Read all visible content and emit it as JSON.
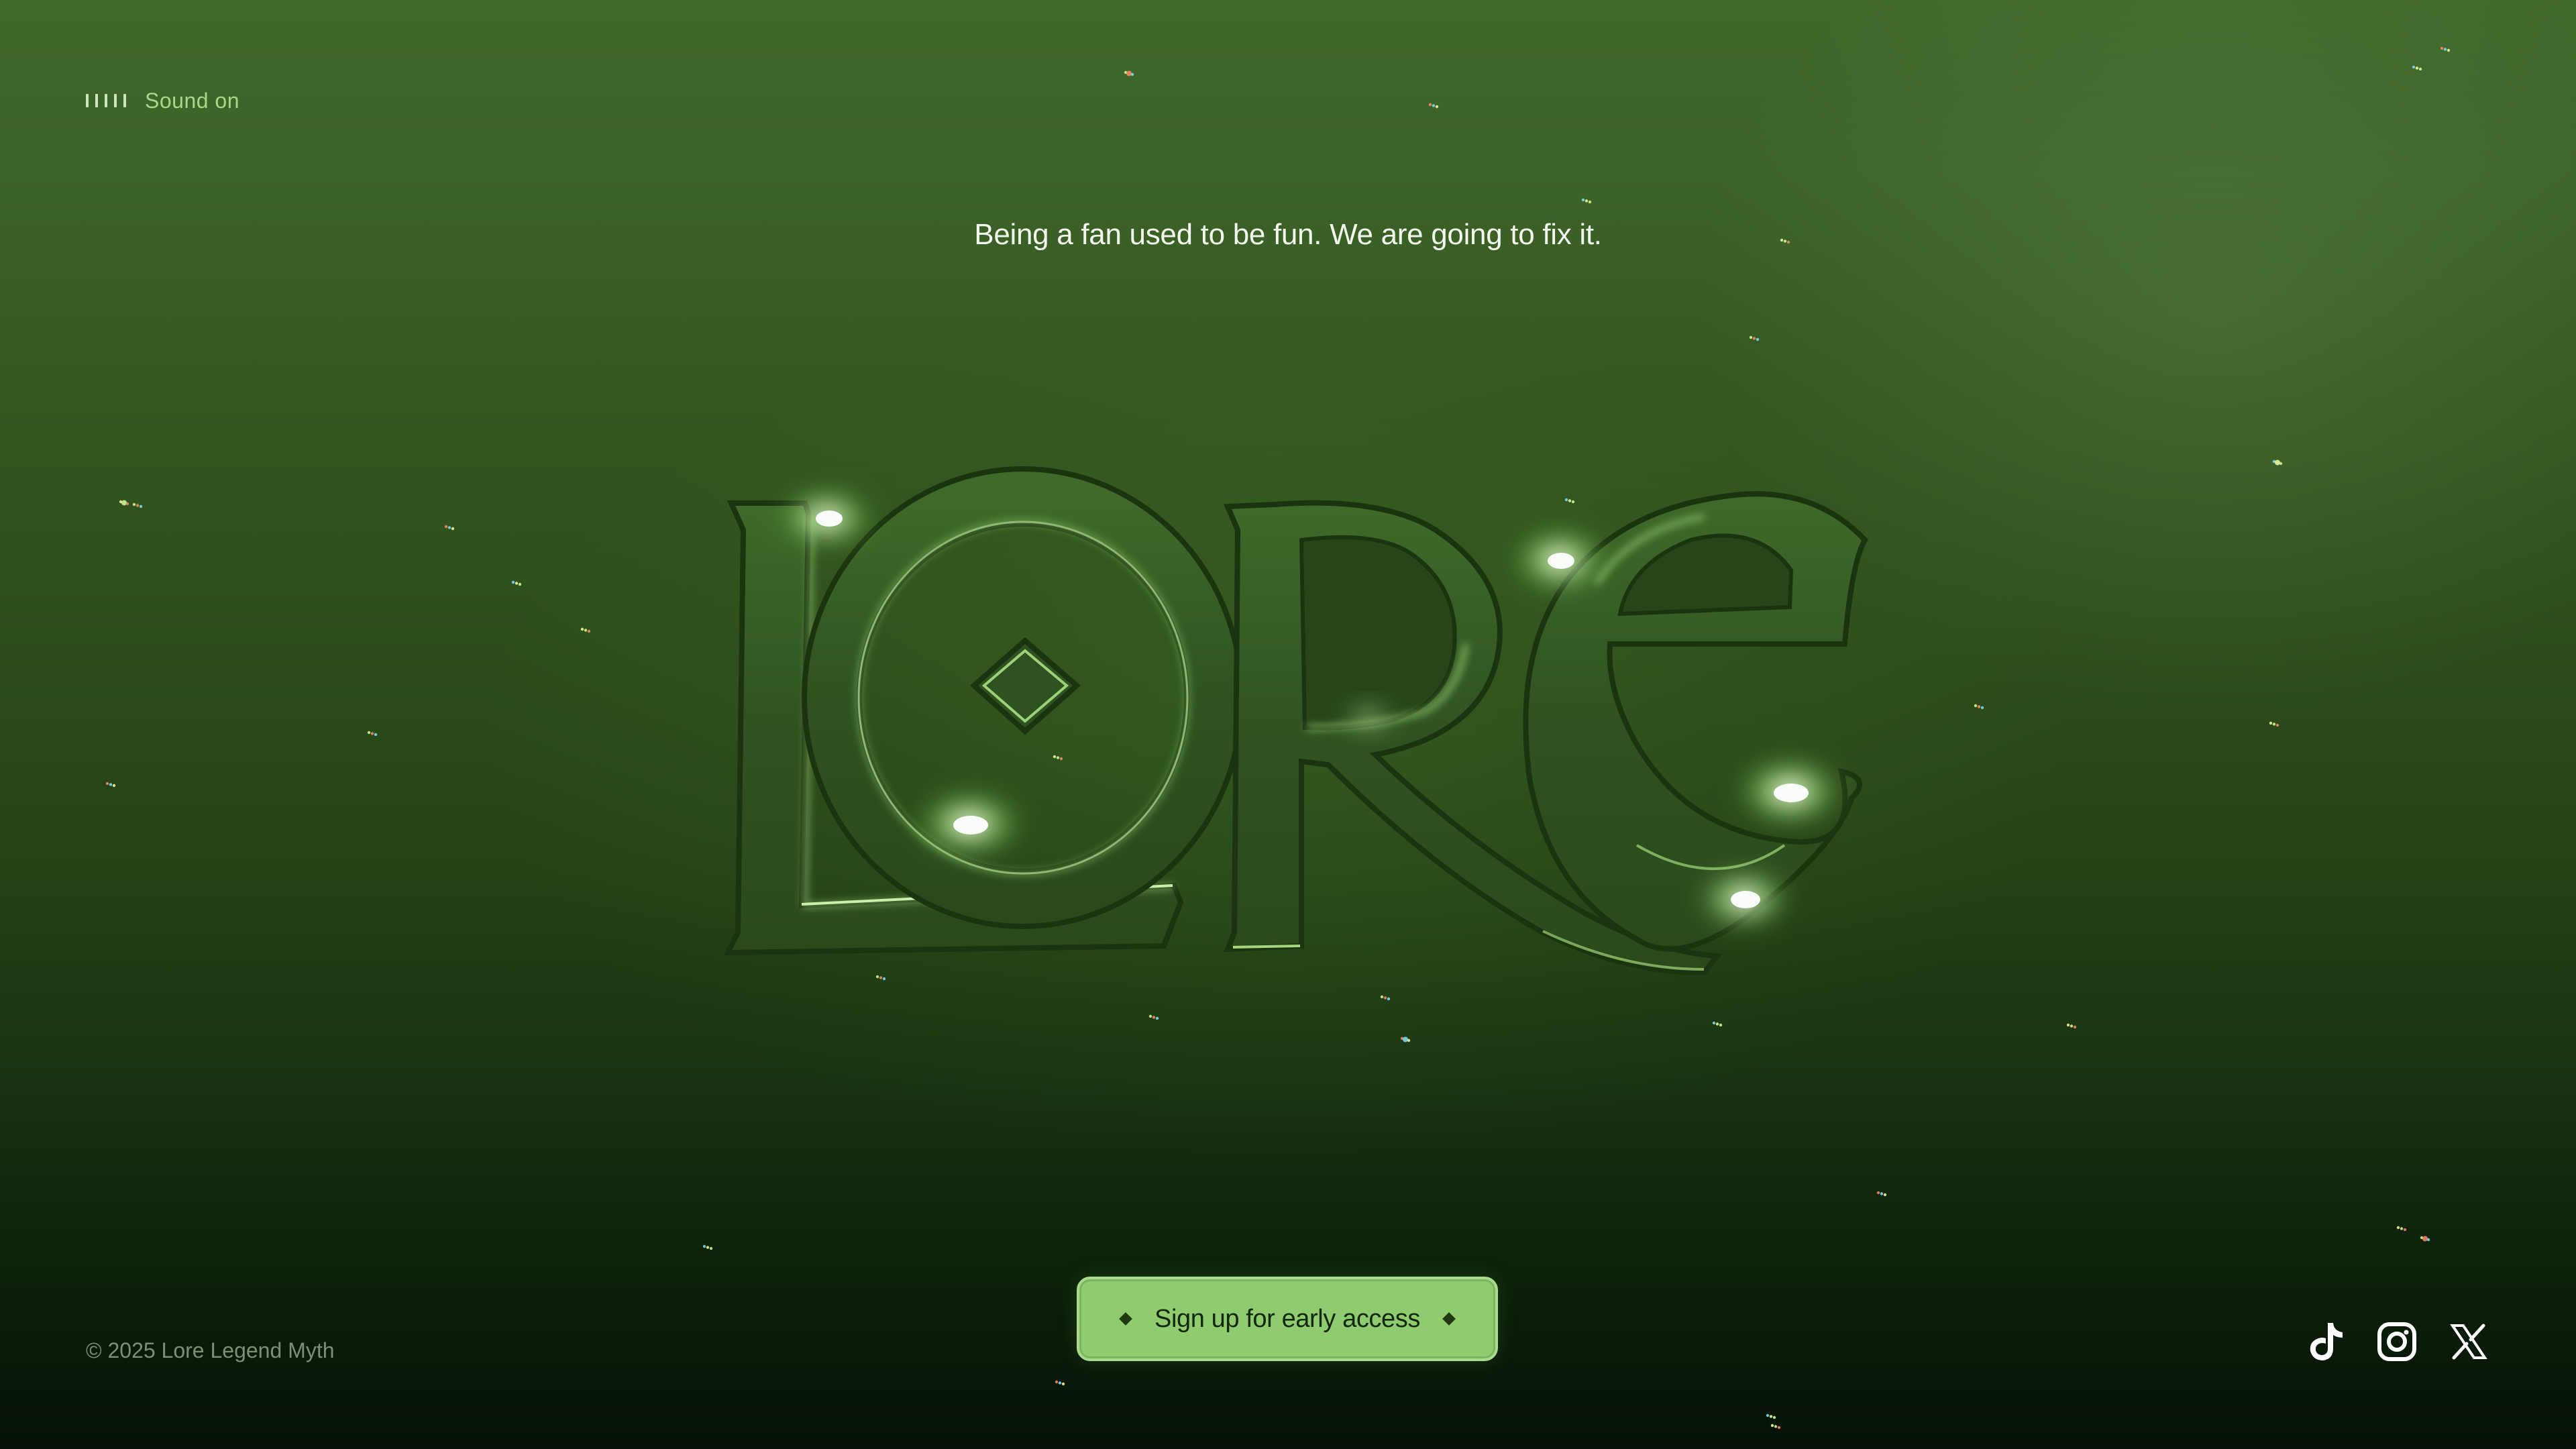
{
  "sound": {
    "label": "Sound on",
    "icon": "sound-bars-icon"
  },
  "hero": {
    "tagline": "Being a fan used to be fun. We are going to fix it.",
    "logo_text": "LORE",
    "logo_icon": "lore-logo"
  },
  "cta": {
    "label": "Sign up for early access",
    "icon": "diamond-icon"
  },
  "footer": {
    "copyright": "© 2025 Lore Legend Myth"
  },
  "social": [
    {
      "name": "TikTok",
      "icon": "tiktok-icon"
    },
    {
      "name": "Instagram",
      "icon": "instagram-icon"
    },
    {
      "name": "X",
      "icon": "x-icon"
    }
  ],
  "colors": {
    "background_top": "#41682b",
    "background_bottom": "#061207",
    "accent": "#8fcb6f",
    "glow": "#c8ff9a",
    "text": "#f3f6ee",
    "muted": "#7d8f74"
  }
}
